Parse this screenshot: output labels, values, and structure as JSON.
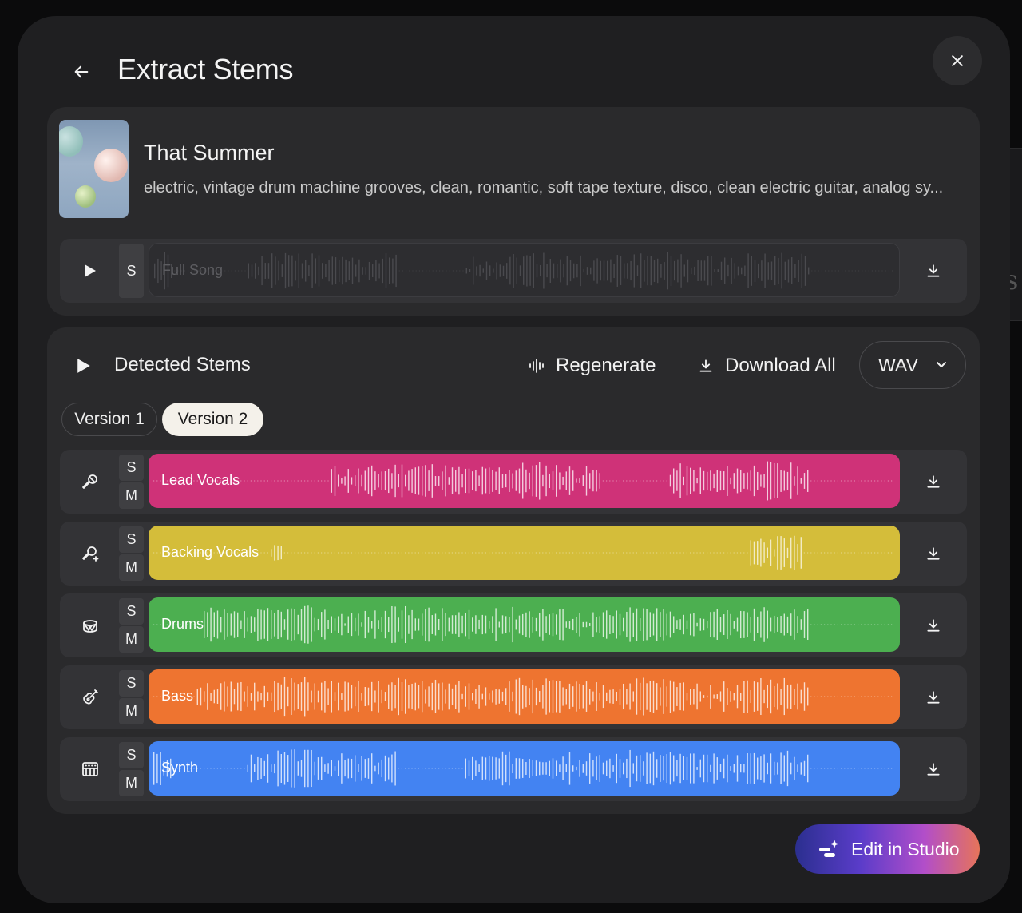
{
  "header": {
    "title": "Extract Stems",
    "back_icon": "arrow-left-icon",
    "close_icon": "close-icon"
  },
  "song": {
    "title": "That Summer",
    "description": "electric, vintage drum machine grooves, clean, romantic, soft tape texture, disco, clean electric guitar, analog sy...",
    "full_track": {
      "label": "Full Song",
      "solo_label": "S"
    }
  },
  "stems_section": {
    "title": "Detected Stems",
    "regenerate_label": "Regenerate",
    "download_all_label": "Download All",
    "format_selected": "WAV",
    "versions": [
      "Version 1",
      "Version 2"
    ],
    "active_version": "Version 2",
    "solo_label": "S",
    "mute_label": "M",
    "stems": [
      {
        "name": "Lead Vocals",
        "icon": "microphone-icon",
        "color": "#cf3278",
        "active_from": 0.24
      },
      {
        "name": "Backing Vocals",
        "icon": "microphone-plus-icon",
        "color": "#d4bd3a",
        "active_from": 0.16
      },
      {
        "name": "Drums",
        "icon": "drum-icon",
        "color": "#4caf50",
        "active_from": 0.07
      },
      {
        "name": "Bass",
        "icon": "guitar-icon",
        "color": "#ee7430",
        "active_from": 0.06
      },
      {
        "name": "Synth",
        "icon": "keyboard-icon",
        "color": "#4383f2",
        "active_from": 0.0
      }
    ]
  },
  "footer": {
    "edit_label": "Edit in Studio"
  },
  "colors": {
    "modal_bg": "#1f1f21",
    "card_bg": "#2a2a2c",
    "row_bg": "#333336"
  }
}
